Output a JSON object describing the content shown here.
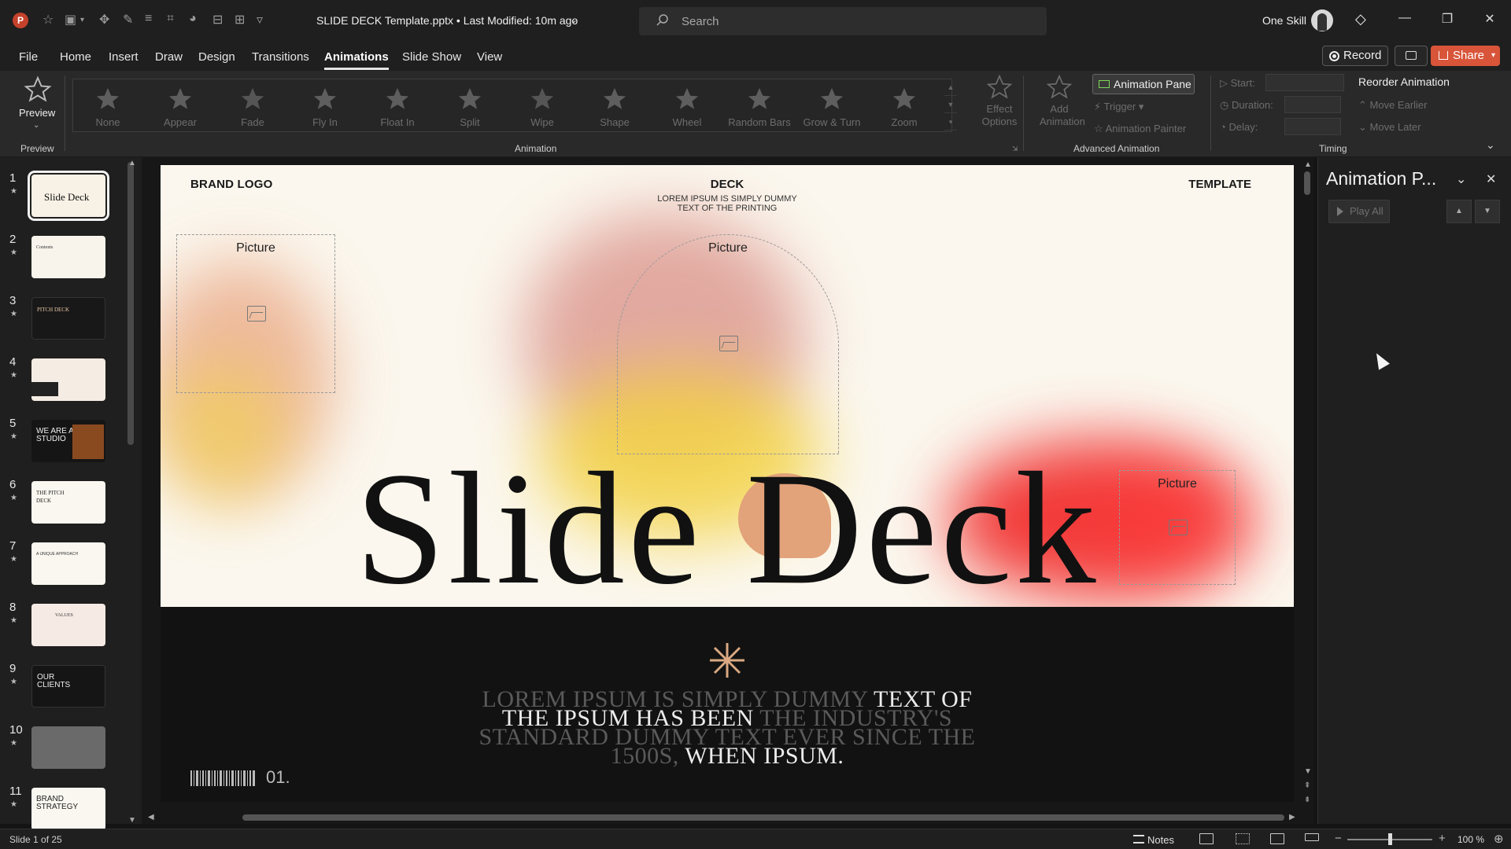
{
  "app": {
    "title": "SLIDE DECK Template.pptx • Last Modified: 10m ago",
    "search_placeholder": "Search",
    "user_name": "One Skill",
    "brand_color": "#d8553a"
  },
  "menu": {
    "tabs": [
      "File",
      "Home",
      "Insert",
      "Draw",
      "Design",
      "Transitions",
      "Animations",
      "Slide Show",
      "View"
    ],
    "active": "Animations",
    "record": "Record",
    "share": "Share"
  },
  "ribbon": {
    "preview": "Preview",
    "groups": {
      "preview": "Preview",
      "animation": "Animation",
      "advanced": "Advanced Animation",
      "timing": "Timing"
    },
    "animations": [
      "None",
      "Appear",
      "Fade",
      "Fly In",
      "Float In",
      "Split",
      "Wipe",
      "Shape",
      "Wheel",
      "Random Bars",
      "Grow & Turn",
      "Zoom"
    ],
    "effect_options": "Effect Options",
    "add_animation": "Add Animation",
    "animation_pane": "Animation Pane",
    "trigger": "Trigger",
    "animation_painter": "Animation Painter",
    "start": "Start:",
    "duration": "Duration:",
    "delay": "Delay:",
    "reorder": "Reorder Animation",
    "move_earlier": "Move Earlier",
    "move_later": "Move Later"
  },
  "thumbnails": [
    {
      "num": "1",
      "label": "Slide Deck"
    },
    {
      "num": "2",
      "label": "Contents"
    },
    {
      "num": "3",
      "label": "PITCH DECK"
    },
    {
      "num": "4",
      "label": ""
    },
    {
      "num": "5",
      "label": "WE ARE A STUDIO"
    },
    {
      "num": "6",
      "label": "THE PITCH DECK"
    },
    {
      "num": "7",
      "label": "A UNIQUE APPROACH"
    },
    {
      "num": "8",
      "label": "VALUES"
    },
    {
      "num": "9",
      "label": "OUR CLIENTS"
    },
    {
      "num": "10",
      "label": ""
    },
    {
      "num": "11",
      "label": "BRAND STRATEGY"
    }
  ],
  "slide": {
    "brand_logo": "BRAND LOGO",
    "deck": "DECK",
    "deck_sub": "LOREM IPSUM IS SIMPLY DUMMY TEXT OF THE PRINTING",
    "template": "TEMPLATE",
    "picture": "Picture",
    "title": "Slide Deck",
    "body_1": "LOREM IPSUM IS SIMPLY DUMMY ",
    "body_2": "TEXT OF THE IPSUM HAS BEEN",
    "body_3": " THE INDUSTRY'S STANDARD DUMMY TEXT EVER SINCE THE 1500S, ",
    "body_4": "WHEN IPSUM.",
    "page_no": "01."
  },
  "pane": {
    "title": "Animation P...",
    "play_all": "Play All"
  },
  "status": {
    "slide_info": "Slide 1 of 25",
    "notes": "Notes",
    "zoom": "100 %"
  }
}
